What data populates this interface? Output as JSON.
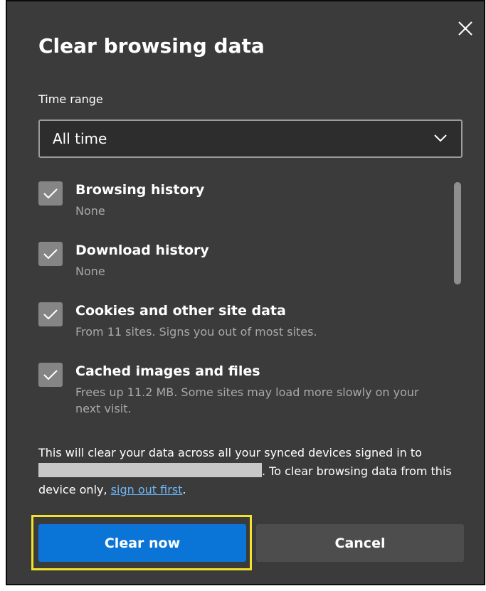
{
  "dialog": {
    "title": "Clear browsing data",
    "time_range": {
      "label": "Time range",
      "value": "All time"
    },
    "items": [
      {
        "label": "Browsing history",
        "description": "None",
        "checked": true
      },
      {
        "label": "Download history",
        "description": "None",
        "checked": true
      },
      {
        "label": "Cookies and other site data",
        "description": "From 11 sites. Signs you out of most sites.",
        "checked": true
      },
      {
        "label": "Cached images and files",
        "description": "Frees up 11.2 MB. Some sites may load more slowly on your next visit.",
        "checked": true
      }
    ],
    "sync_note": {
      "part1": "This will clear your data across all your synced devices signed in to",
      "part2": ". To clear browsing data from this device only, ",
      "link": "sign out first",
      "part3": "."
    },
    "buttons": {
      "primary": "Clear now",
      "secondary": "Cancel"
    }
  },
  "colors": {
    "background": "#3b3b3b",
    "primary_button": "#0b74d7",
    "link": "#6cb6f7",
    "highlight": "#f2e22b"
  },
  "icons": {
    "close": "close-icon",
    "dropdown": "chevron-down-icon",
    "check": "checkmark-icon"
  }
}
